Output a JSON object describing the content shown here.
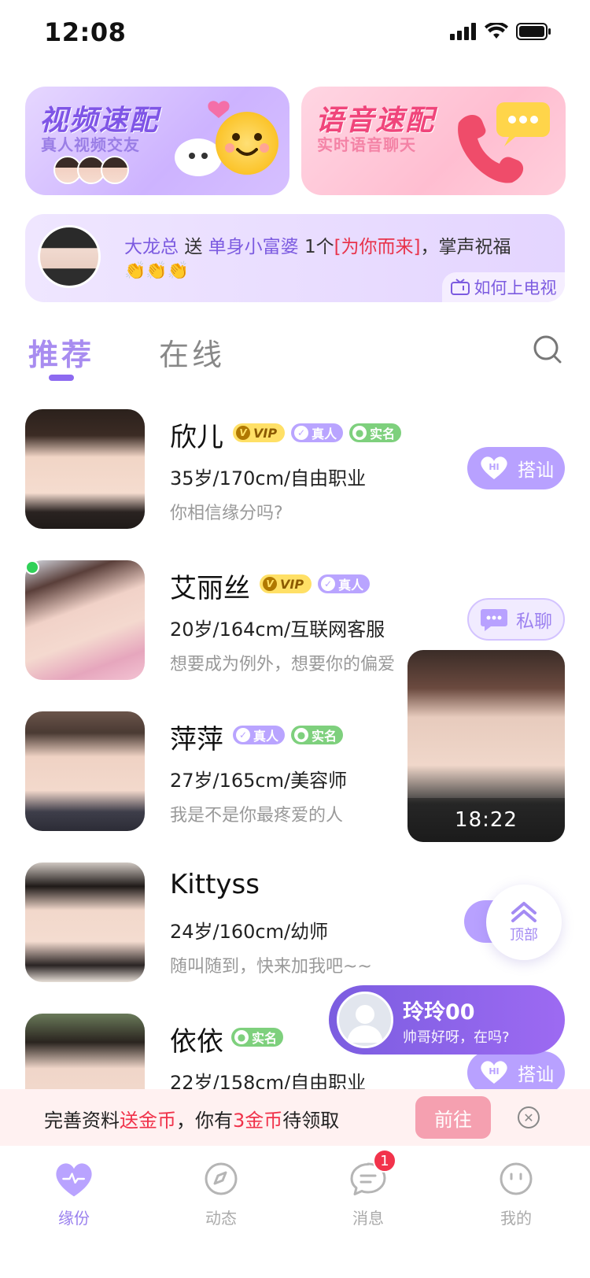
{
  "status_bar": {
    "time": "12:08"
  },
  "banners": {
    "video": {
      "title": "视频速配",
      "subtitle": "真人视频交友"
    },
    "voice": {
      "title": "语音速配",
      "subtitle": "实时语音聊天"
    }
  },
  "gift_ticker": {
    "sender": "大龙总",
    "verb": "送",
    "receiver": "单身小富婆",
    "count": "1个",
    "gift": "[为你而来]",
    "tail": "，掌声祝福",
    "claps": "👏👏👏",
    "tv_link": "如何上电视"
  },
  "tabs": {
    "recommend": "推荐",
    "online": "在线"
  },
  "users": [
    {
      "name": "欣儿",
      "meta": "35岁/170cm/自由职业",
      "bio": "你相信缘分吗?",
      "action": "搭讪",
      "vip": "VIP",
      "real": "真人",
      "ident": "实名"
    },
    {
      "name": "艾丽丝",
      "meta": "20岁/164cm/互联网客服",
      "bio": "想要成为例外，想要你的偏爱",
      "action": "私聊",
      "vip": "VIP",
      "real": "真人"
    },
    {
      "name": "萍萍",
      "meta": "27岁/165cm/美容师",
      "bio": "我是不是你最疼爱的人",
      "real": "真人",
      "ident": "实名"
    },
    {
      "name": "Kittyss",
      "meta": "24岁/160cm/幼师",
      "bio": "随叫随到，快来加我吧~~"
    },
    {
      "name": "依依",
      "meta": "22岁/158cm/自由职业",
      "action": "搭讪",
      "ident": "实名"
    }
  ],
  "floating_video": {
    "timer": "18:22"
  },
  "back_to_top": {
    "label": "顶部"
  },
  "message_popup": {
    "name": "玲玲00",
    "message": "帅哥好呀，在吗?"
  },
  "notice": {
    "part1": "完善资料",
    "part2": "送金币",
    "part3": "，你有",
    "part4": "3金币",
    "part5": "待领取",
    "button": "前往"
  },
  "tabbar": {
    "items": [
      {
        "label": "缘份"
      },
      {
        "label": "动态"
      },
      {
        "label": "消息",
        "badge": "1"
      },
      {
        "label": "我的"
      }
    ]
  },
  "colors": {
    "accent": "#8d6af0",
    "hi_button": "#b8a1ff",
    "online": "#30d158",
    "notice_highlight": "#f0324a"
  },
  "icons": [
    "signal-icon",
    "wifi-icon",
    "battery-icon",
    "search-icon",
    "tv-icon",
    "heart-icon",
    "chat-bubble-icon",
    "compass-icon",
    "message-icon",
    "smile-icon",
    "chevron-up-icon",
    "close-icon"
  ]
}
